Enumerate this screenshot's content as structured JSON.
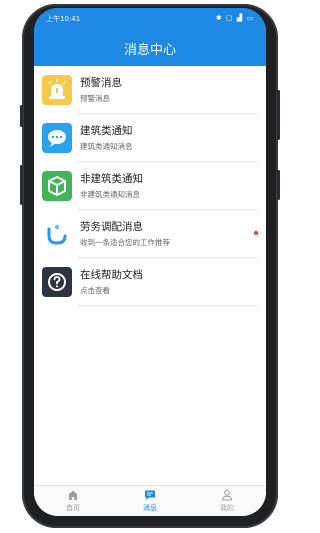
{
  "status_bar": {
    "time": "上午10:41",
    "icons_text": "✱ ▢ ▟ ▭"
  },
  "header": {
    "title": "消息中心"
  },
  "messages": [
    {
      "title": "预警消息",
      "subtitle": "预警消息",
      "icon": "warning-alarm-icon",
      "color": "#f7c948",
      "unread": false
    },
    {
      "title": "建筑类通知",
      "subtitle": "建筑类通知消息",
      "icon": "chat-bubble-icon",
      "color": "#29a3ee",
      "unread": false
    },
    {
      "title": "非建筑类通知",
      "subtitle": "非建筑类通知消息",
      "icon": "cube-icon",
      "color": "#43b559",
      "unread": false
    },
    {
      "title": "劳务调配消息",
      "subtitle": "收到一条适合您的工作推荐",
      "icon": "labor-dispatch-icon",
      "color": "#ffffff",
      "unread": true
    },
    {
      "title": "在线帮助文档",
      "subtitle": "点击查看",
      "icon": "help-question-icon",
      "color": "#2b3440",
      "unread": false
    }
  ],
  "tabbar": {
    "home": {
      "label": "首页",
      "icon": "home-icon"
    },
    "messages": {
      "label": "消息",
      "icon": "message-icon",
      "active": true
    },
    "mine": {
      "label": "我的",
      "icon": "person-icon"
    }
  },
  "colors": {
    "primary": "#1e88e5",
    "unread_dot": "#e53935"
  }
}
